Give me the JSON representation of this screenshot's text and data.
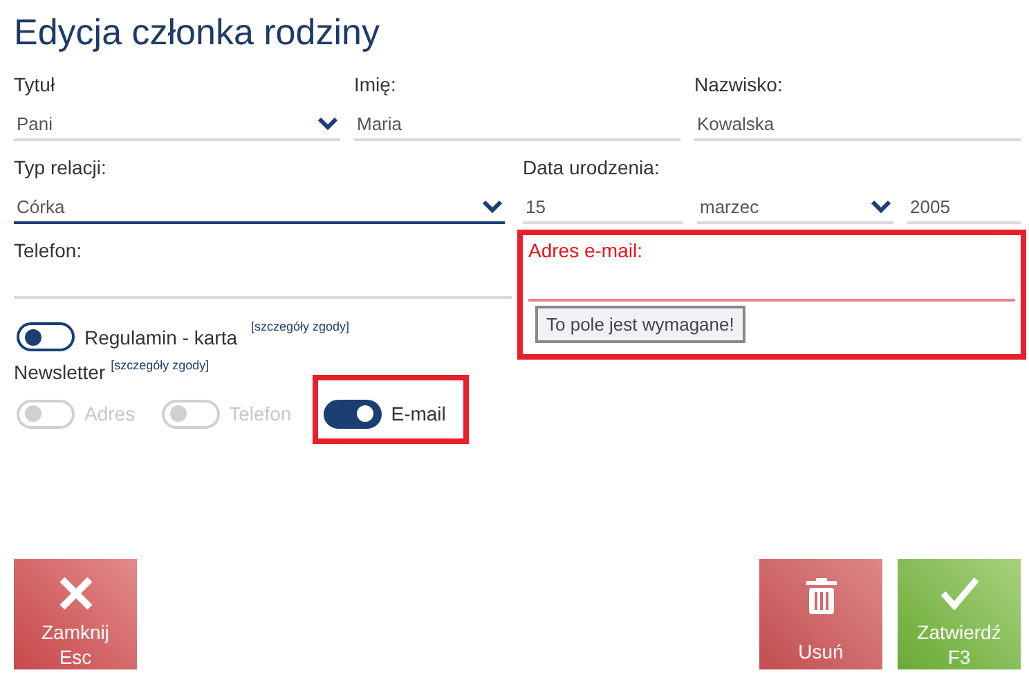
{
  "title": "Edycja członka rodziny",
  "fields": [
    {
      "label": "Tytuł",
      "value": "Pani",
      "kind": "select",
      "focused": false
    },
    {
      "label": "Imię:",
      "value": "Maria",
      "kind": "text",
      "focused": false
    },
    {
      "label": "Nazwisko:",
      "value": "Kowalska",
      "kind": "text",
      "focused": false
    }
  ],
  "relation": {
    "label": "Typ relacji:",
    "value": "Córka",
    "kind": "select",
    "focused": true
  },
  "birth_date": {
    "label": "Data urodzenia:",
    "day": "15",
    "month": "marzec",
    "year": "2005"
  },
  "phone": {
    "label": "Telefon:",
    "focused": false
  },
  "email": {
    "label": "Adres e-mail:",
    "error": true,
    "highlighted": true,
    "message": "To pole jest wymagane!"
  },
  "regulamin": {
    "label": "Regulamin - karta",
    "link": "[szczegóły zgody]",
    "on": false,
    "disabled": false
  },
  "newsletter": {
    "label": "Newsletter",
    "link": "[szczegóły zgody]",
    "options": [
      {
        "label": "Adres",
        "on": false,
        "disabled": true,
        "highlighted": false
      },
      {
        "label": "Telefon",
        "on": false,
        "disabled": true,
        "highlighted": false
      },
      {
        "label": "E-mail",
        "on": true,
        "disabled": false,
        "highlighted": true
      }
    ]
  },
  "buttons": [
    {
      "kind": "close",
      "label": "Zamknij",
      "shortcut": "Esc"
    },
    {
      "kind": "delete",
      "label": "Usuń"
    },
    {
      "kind": "confirm",
      "label": "Zatwierdź",
      "shortcut": "F3"
    }
  ]
}
